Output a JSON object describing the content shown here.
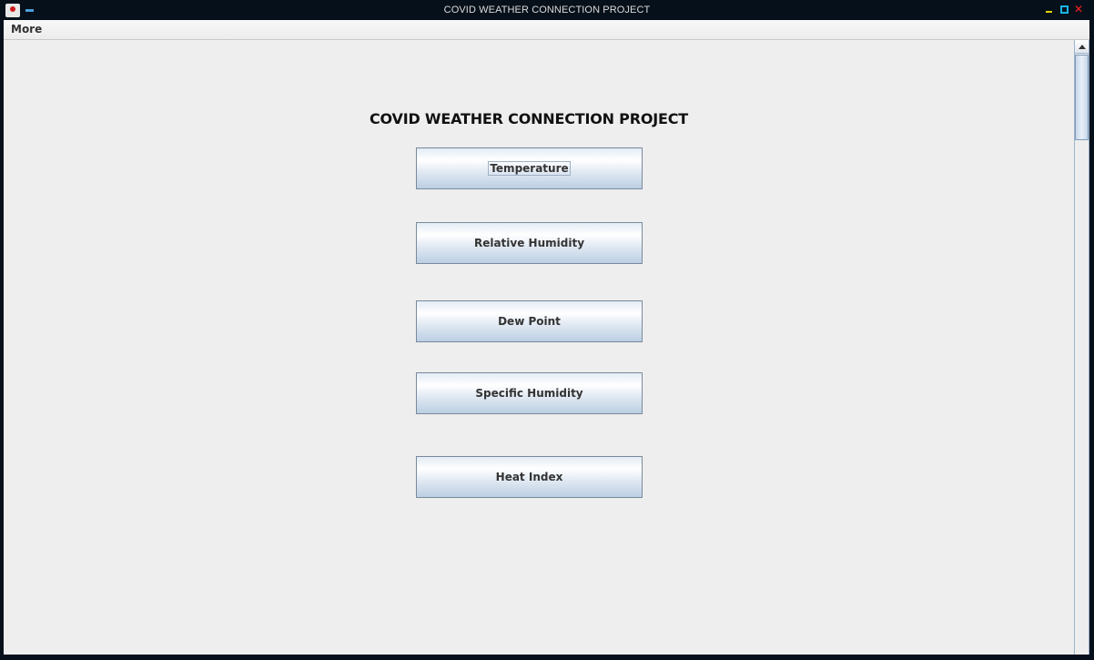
{
  "window": {
    "title": "COVID WEATHER CONNECTION PROJECT",
    "controls": {
      "minimize_icon": "minimize-icon",
      "maximize_icon": "maximize-icon",
      "close_icon": "close-icon",
      "close_glyph": "✕"
    },
    "app_icon": "java-app-icon"
  },
  "menubar": {
    "items": [
      {
        "label": "More"
      }
    ]
  },
  "main": {
    "heading": "COVID WEATHER CONNECTION PROJECT",
    "buttons": [
      {
        "label": "Temperature",
        "focused": true
      },
      {
        "label": "Relative Humidity"
      },
      {
        "label": "Dew Point"
      },
      {
        "label": "Specific Humidity"
      },
      {
        "label": "Heat Index"
      }
    ]
  },
  "colors": {
    "titlebar_bg": "#06101a",
    "content_bg": "#eeeeee",
    "button_border": "#7a8a9c",
    "minimize": "#e0d400",
    "maximize": "#18b4e6",
    "close": "#ff2020"
  }
}
